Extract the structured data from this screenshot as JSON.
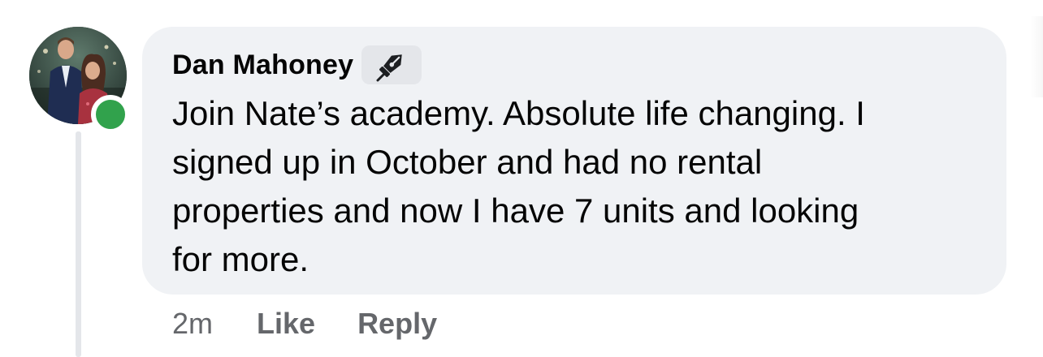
{
  "comment": {
    "author": "Dan Mahoney",
    "badge_icon": "pen-nib-icon",
    "lines": [
      "Join Nate’s academy. Absolute life changing. I",
      "signed up in October and had no rental",
      "properties and now I have 7 units and looking",
      "for more."
    ],
    "online_status_color": "#31a24c",
    "bubble_color": "#f0f2f5"
  },
  "actions": {
    "timestamp": "2m",
    "like_label": "Like",
    "reply_label": "Reply"
  }
}
